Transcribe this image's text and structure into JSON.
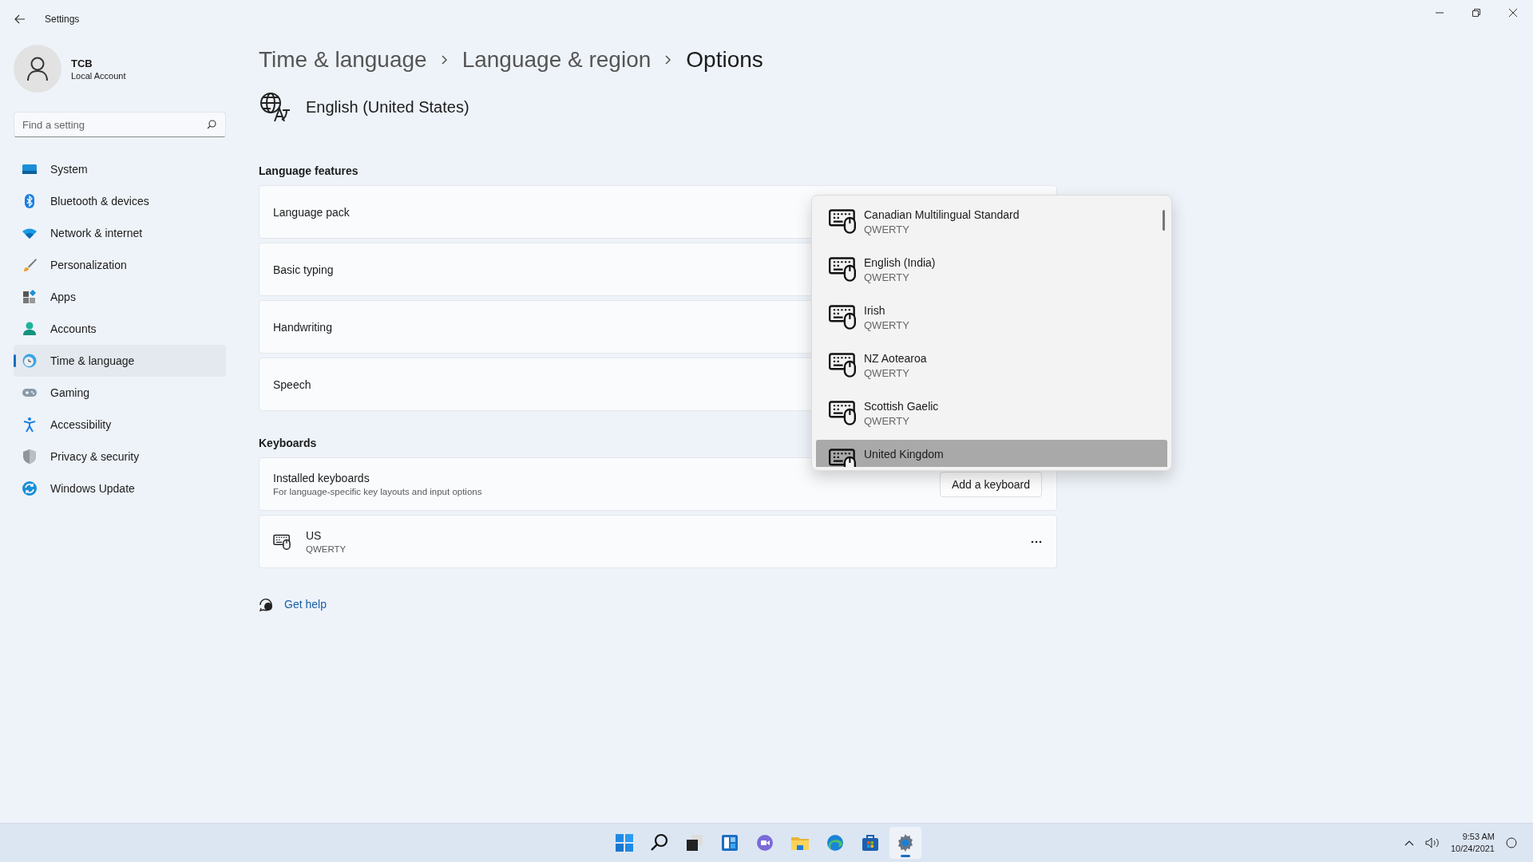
{
  "window": {
    "title": "Settings"
  },
  "profile": {
    "name": "TCB",
    "account": "Local Account"
  },
  "search": {
    "placeholder": "Find a setting"
  },
  "sidebar": {
    "items": [
      {
        "label": "System",
        "kind": "system",
        "selected": false
      },
      {
        "label": "Bluetooth & devices",
        "kind": "bluetooth",
        "selected": false
      },
      {
        "label": "Network & internet",
        "kind": "network",
        "selected": false
      },
      {
        "label": "Personalization",
        "kind": "brush",
        "selected": false
      },
      {
        "label": "Apps",
        "kind": "apps",
        "selected": false
      },
      {
        "label": "Accounts",
        "kind": "accounts",
        "selected": false
      },
      {
        "label": "Time & language",
        "kind": "time",
        "selected": true
      },
      {
        "label": "Gaming",
        "kind": "gaming",
        "selected": false
      },
      {
        "label": "Accessibility",
        "kind": "accessibility",
        "selected": false
      },
      {
        "label": "Privacy & security",
        "kind": "shield",
        "selected": false
      },
      {
        "label": "Windows Update",
        "kind": "update",
        "selected": false
      }
    ]
  },
  "breadcrumb": [
    "Time & language",
    "Language & region",
    "Options"
  ],
  "heading": "English (United States)",
  "sections": [
    {
      "title": "Language features",
      "cards": [
        {
          "kind": "setting",
          "label": "Language pack"
        },
        {
          "kind": "setting",
          "label": "Basic typing"
        },
        {
          "kind": "setting",
          "label": "Handwriting"
        },
        {
          "kind": "setting",
          "label": "Speech"
        }
      ]
    },
    {
      "title": "Keyboards",
      "cards": [
        {
          "kind": "action",
          "label": "Installed keyboards",
          "description": "For language-specific key layouts and input options",
          "button": "Add a keyboard"
        },
        {
          "kind": "keyboard",
          "label": "US",
          "description": "QWERTY"
        }
      ]
    }
  ],
  "help_link": "Get help",
  "dropdown": {
    "items": [
      {
        "name": "Canadian Multilingual Standard",
        "layout": "QWERTY",
        "selected": false
      },
      {
        "name": "English (India)",
        "layout": "QWERTY",
        "selected": false
      },
      {
        "name": "Irish",
        "layout": "QWERTY",
        "selected": false
      },
      {
        "name": "NZ Aotearoa",
        "layout": "QWERTY",
        "selected": false
      },
      {
        "name": "Scottish Gaelic",
        "layout": "QWERTY",
        "selected": false
      },
      {
        "name": "United Kingdom",
        "selected": true
      }
    ]
  },
  "taskbar": {
    "apps": [
      {
        "kind": "start",
        "active": false
      },
      {
        "kind": "search",
        "active": false
      },
      {
        "kind": "taskview",
        "active": false
      },
      {
        "kind": "widgets",
        "active": false
      },
      {
        "kind": "chat",
        "active": false
      },
      {
        "kind": "explorer",
        "active": false
      },
      {
        "kind": "edge",
        "active": false
      },
      {
        "kind": "store",
        "active": false
      },
      {
        "kind": "settings",
        "active": true
      }
    ]
  },
  "tray": {
    "time": "9:53 AM",
    "date": "10/24/2021"
  }
}
